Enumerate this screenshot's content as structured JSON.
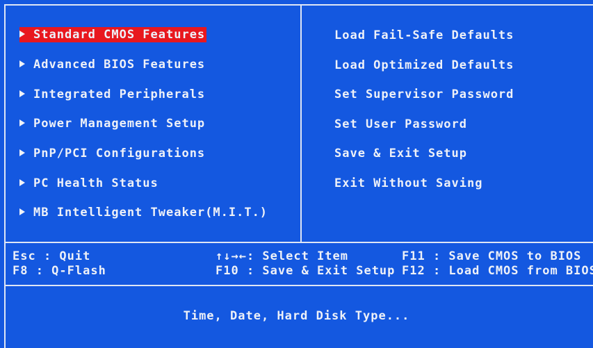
{
  "left_menu": [
    {
      "label": "Standard CMOS Features",
      "selected": true
    },
    {
      "label": "Advanced BIOS Features",
      "selected": false
    },
    {
      "label": "Integrated Peripherals",
      "selected": false
    },
    {
      "label": "Power Management Setup",
      "selected": false
    },
    {
      "label": "PnP/PCI Configurations",
      "selected": false
    },
    {
      "label": "PC Health Status",
      "selected": false
    },
    {
      "label": "MB Intelligent Tweaker(M.I.T.)",
      "selected": false
    }
  ],
  "right_menu": [
    {
      "label": "Load Fail-Safe Defaults"
    },
    {
      "label": "Load Optimized Defaults"
    },
    {
      "label": "Set Supervisor Password"
    },
    {
      "label": "Set User Password"
    },
    {
      "label": "Save & Exit Setup"
    },
    {
      "label": "Exit Without Saving"
    }
  ],
  "help_bar": {
    "row1": {
      "left": "Esc  : Quit",
      "middle": "↑↓→←: Select Item",
      "right": "F11  : Save CMOS to BIOS"
    },
    "row2": {
      "left": "F8   : Q-Flash",
      "middle": "F10  : Save & Exit Setup",
      "right": "F12  : Load CMOS from BIOS"
    }
  },
  "status_line": "Time, Date, Hard Disk Type...",
  "colors": {
    "background": "#1458e0",
    "text": "#eef1f8",
    "highlight": "#e8171e",
    "frame": "#dfe6f5"
  }
}
